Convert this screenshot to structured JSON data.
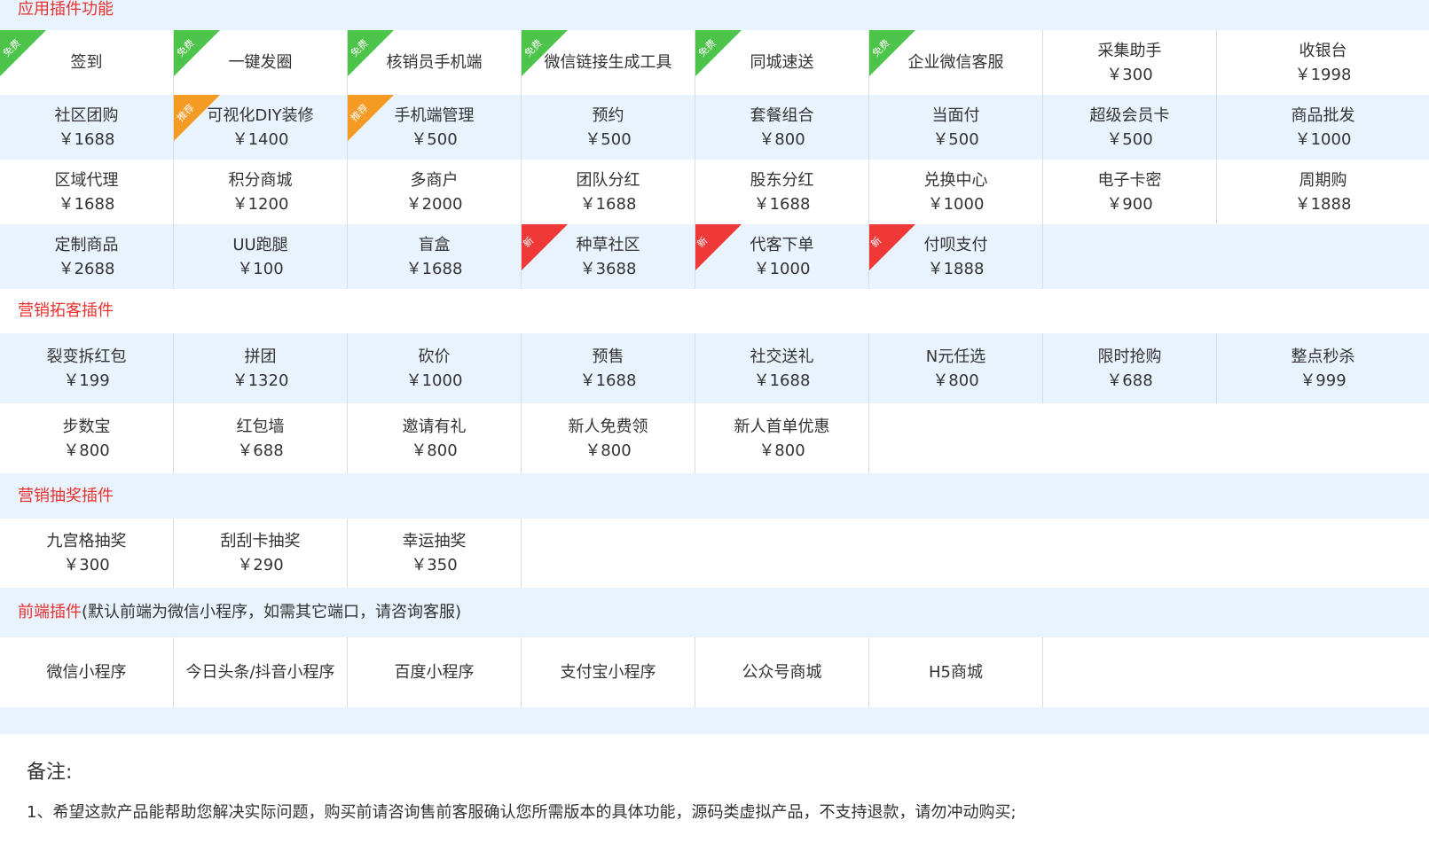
{
  "sections": {
    "app": "应用插件功能",
    "marketing_acquire": "营销拓客插件",
    "marketing_lottery": "营销抽奖插件",
    "frontend": "前端插件",
    "frontend_note": "(默认前端为微信小程序，如需其它端口，请咨询客服)"
  },
  "badges": {
    "free": "免费",
    "recommend": "推荐",
    "new": "新"
  },
  "app_rows": [
    [
      {
        "name": "签到",
        "price": "",
        "badge": "free"
      },
      {
        "name": "一键发圈",
        "price": "",
        "badge": "free"
      },
      {
        "name": "核销员手机端",
        "price": "",
        "badge": "free"
      },
      {
        "name": "微信链接生成工具",
        "price": "",
        "badge": "free"
      },
      {
        "name": "同城速送",
        "price": "",
        "badge": "free"
      },
      {
        "name": "企业微信客服",
        "price": "",
        "badge": "free"
      },
      {
        "name": "采集助手",
        "price": "￥300",
        "badge": ""
      },
      {
        "name": "收银台",
        "price": "￥1998",
        "badge": ""
      }
    ],
    [
      {
        "name": "社区团购",
        "price": "￥1688",
        "badge": ""
      },
      {
        "name": "可视化DIY装修",
        "price": "￥1400",
        "badge": "recommend"
      },
      {
        "name": "手机端管理",
        "price": "￥500",
        "badge": "recommend"
      },
      {
        "name": "预约",
        "price": "￥500",
        "badge": ""
      },
      {
        "name": "套餐组合",
        "price": "￥800",
        "badge": ""
      },
      {
        "name": "当面付",
        "price": "￥500",
        "badge": ""
      },
      {
        "name": "超级会员卡",
        "price": "￥500",
        "badge": ""
      },
      {
        "name": "商品批发",
        "price": "￥1000",
        "badge": ""
      }
    ],
    [
      {
        "name": "区域代理",
        "price": "￥1688",
        "badge": ""
      },
      {
        "name": "积分商城",
        "price": "￥1200",
        "badge": ""
      },
      {
        "name": "多商户",
        "price": "￥2000",
        "badge": ""
      },
      {
        "name": "团队分红",
        "price": "￥1688",
        "badge": ""
      },
      {
        "name": "股东分红",
        "price": "￥1688",
        "badge": ""
      },
      {
        "name": "兑换中心",
        "price": "￥1000",
        "badge": ""
      },
      {
        "name": "电子卡密",
        "price": "￥900",
        "badge": ""
      },
      {
        "name": "周期购",
        "price": "￥1888",
        "badge": ""
      }
    ],
    [
      {
        "name": "定制商品",
        "price": "￥2688",
        "badge": ""
      },
      {
        "name": "UU跑腿",
        "price": "￥100",
        "badge": ""
      },
      {
        "name": "盲盒",
        "price": "￥1688",
        "badge": ""
      },
      {
        "name": "种草社区",
        "price": "￥3688",
        "badge": "new"
      },
      {
        "name": "代客下单",
        "price": "￥1000",
        "badge": "new"
      },
      {
        "name": "付呗支付",
        "price": "￥1888",
        "badge": "new"
      }
    ]
  ],
  "acquire_rows": [
    [
      {
        "name": "裂变拆红包",
        "price": "￥199"
      },
      {
        "name": "拼团",
        "price": "￥1320"
      },
      {
        "name": "砍价",
        "price": "￥1000"
      },
      {
        "name": "预售",
        "price": "￥1688"
      },
      {
        "name": "社交送礼",
        "price": "￥1688"
      },
      {
        "name": "N元任选",
        "price": "￥800"
      },
      {
        "name": "限时抢购",
        "price": "￥688"
      },
      {
        "name": "整点秒杀",
        "price": "￥999"
      }
    ],
    [
      {
        "name": "步数宝",
        "price": "￥800"
      },
      {
        "name": "红包墙",
        "price": "￥688"
      },
      {
        "name": "邀请有礼",
        "price": "￥800"
      },
      {
        "name": "新人免费领",
        "price": "￥800"
      },
      {
        "name": "新人首单优惠",
        "price": "￥800"
      }
    ]
  ],
  "lottery_rows": [
    [
      {
        "name": "九宫格抽奖",
        "price": "￥300"
      },
      {
        "name": "刮刮卡抽奖",
        "price": "￥290"
      },
      {
        "name": "幸运抽奖",
        "price": "￥350"
      }
    ]
  ],
  "frontend_rows": [
    [
      {
        "name": "微信小程序",
        "price": ""
      },
      {
        "name": "今日头条/抖音小程序",
        "price": ""
      },
      {
        "name": "百度小程序",
        "price": ""
      },
      {
        "name": "支付宝小程序",
        "price": ""
      },
      {
        "name": "公众号商城",
        "price": ""
      },
      {
        "name": "H5商城",
        "price": ""
      }
    ]
  ],
  "notes": {
    "title": "备注:",
    "line1": "1、希望这款产品能帮助您解决实际问题，购买前请咨询售前客服确认您所需版本的具体功能，源码类虚拟产品，不支持退款，请勿冲动购买;"
  },
  "colors": {
    "accent": "#e8312f",
    "row_blue": "#e8f3fd",
    "free": "#4cc449",
    "recommend": "#f59a23",
    "new": "#ef3838"
  }
}
